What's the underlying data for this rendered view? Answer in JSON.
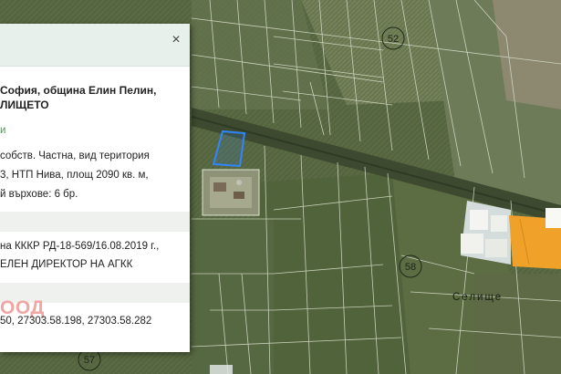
{
  "popup": {
    "close_label": "×",
    "address_line1": "София, община Елин Пелин,",
    "address_line2": "ЛИЩЕТО",
    "section_link": "и",
    "prop_line1": "собств. Частна, вид територия",
    "prop_line2": "3, НТП Нива, площ 2090 кв. м,",
    "prop_line3": "й върхове: 6 бр.",
    "order_line1": "на КККР РД-18-569/16.08.2019 г.,",
    "order_line2": "ЕЛЕН ДИРЕКТОР НА АГКК",
    "company": "ООД",
    "neighbors": "50, 27303.58.198, 27303.58.282"
  },
  "map": {
    "parcel_labels": [
      "52",
      "58",
      "57"
    ],
    "village_label": "Селище"
  },
  "colors": {
    "field_dark": "#4f603d",
    "field_light": "#6f7e58",
    "parcel_lines": "#d8dccd",
    "selected_parcel": "#2f86ff",
    "orange_roof": "#f0a12a"
  }
}
